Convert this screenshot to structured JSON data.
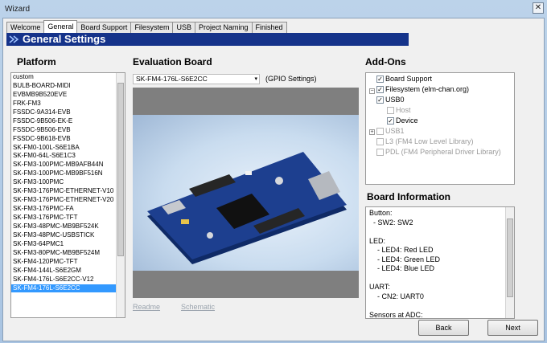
{
  "window": {
    "title": "Wizard",
    "close_glyph": "✕"
  },
  "tabs": [
    {
      "label": "Welcome"
    },
    {
      "label": "General"
    },
    {
      "label": "Board Support"
    },
    {
      "label": "Filesystem"
    },
    {
      "label": "USB"
    },
    {
      "label": "Project Naming"
    },
    {
      "label": "Finished"
    }
  ],
  "active_tab": "General",
  "banner": {
    "title": "General Settings"
  },
  "platform": {
    "heading": "Platform",
    "items": [
      "custom",
      "BULB-BOARD-MIDI",
      "EVBMB9B520EVE",
      "FRK-FM3",
      "FSSDC-9A314-EVB",
      "FSSDC-9B506-EK-E",
      "FSSDC-9B506-EVB",
      "FSSDC-9B618-EVB",
      "SK-FM0-100L-S6E1BA",
      "SK-FM0-64L-S6E1C3",
      "SK-FM3-100PMC-MB9AFB44N",
      "SK-FM3-100PMC-MB9BF516N",
      "SK-FM3-100PMC",
      "SK-FM3-176PMC-ETHERNET-V10",
      "SK-FM3-176PMC-ETHERNET-V20",
      "SK-FM3-176PMC-FA",
      "SK-FM3-176PMC-TFT",
      "SK-FM3-48PMC-MB9BF524K",
      "SK-FM3-48PMC-USBSTICK",
      "SK-FM3-64PMC1",
      "SK-FM3-80PMC-MB9BF524M",
      "SK-FM4-120PMC-TFT",
      "SK-FM4-144L-S6E2GM",
      "SK-FM4-176L-S6E2CC-V12",
      "SK-FM4-176L-S6E2CC"
    ],
    "selected": "SK-FM4-176L-S6E2CC"
  },
  "evaluation_board": {
    "heading": "Evaluation Board",
    "selected": "SK-FM4-176L-S6E2CC",
    "dropdown_glyph": "▾",
    "gpio_label": "(GPIO Settings)",
    "readme_link": "Readme",
    "schematic_link": "Schematic"
  },
  "addons": {
    "heading": "Add-Ons",
    "nodes": [
      {
        "label": "Board Support",
        "checked": true,
        "enabled": true
      },
      {
        "label": "Filesystem (elm-chan.org)",
        "checked": true,
        "enabled": true
      },
      {
        "label": "USB0",
        "checked": true,
        "enabled": true
      },
      {
        "label": "Host",
        "checked": false,
        "enabled": false
      },
      {
        "label": "Device",
        "checked": true,
        "enabled": true
      },
      {
        "label": "USB1",
        "checked": false,
        "enabled": false
      },
      {
        "label": "L3 (FM4 Low Level Library)",
        "checked": false,
        "enabled": false
      },
      {
        "label": "PDL (FM4 Peripheral Driver Library)",
        "checked": false,
        "enabled": false
      }
    ]
  },
  "board_information": {
    "heading": "Board Information",
    "lines": [
      "Button:",
      "  - SW2: SW2",
      "",
      "LED:",
      "    - LED4: Red LED",
      "    - LED4: Green LED",
      "    - LED4: Blue LED",
      "",
      "UART:",
      "    - CN2: UART0",
      "",
      "Sensors at ADC:"
    ]
  },
  "buttons": {
    "back": "Back",
    "next": "Next"
  },
  "colors": {
    "banner": "#15338a",
    "selection": "#3399ff",
    "pcb": "#1d3f8f"
  }
}
